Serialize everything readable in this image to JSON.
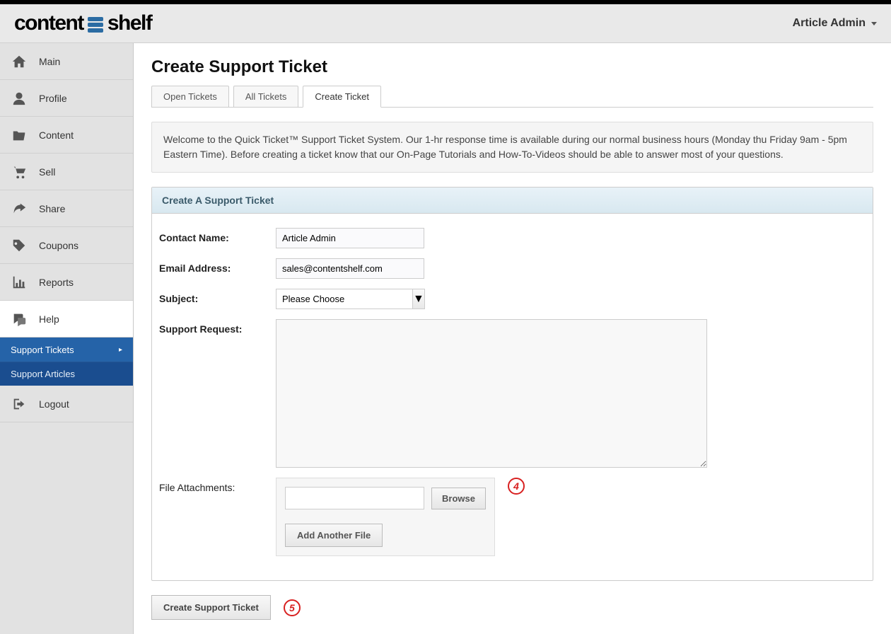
{
  "header": {
    "logo_left": "content",
    "logo_right": "shelf",
    "user_menu": "Article Admin"
  },
  "sidebar": {
    "items": [
      {
        "label": "Main"
      },
      {
        "label": "Profile"
      },
      {
        "label": "Content"
      },
      {
        "label": "Sell"
      },
      {
        "label": "Share"
      },
      {
        "label": "Coupons"
      },
      {
        "label": "Reports"
      },
      {
        "label": "Help"
      }
    ],
    "help_sub": [
      {
        "label": "Support Tickets"
      },
      {
        "label": "Support Articles"
      }
    ],
    "logout": "Logout"
  },
  "page": {
    "title": "Create Support Ticket",
    "tabs": [
      {
        "label": "Open Tickets"
      },
      {
        "label": "All Tickets"
      },
      {
        "label": "Create Ticket"
      }
    ],
    "info": "Welcome to the Quick Ticket™ Support Ticket System. Our 1-hr response time is available during our normal business hours (Monday thu Friday 9am - 5pm Eastern Time). Before creating a ticket know that our On-Page Tutorials and How-To-Videos should be able to answer most of your questions.",
    "panel_title": "Create A Support Ticket",
    "form": {
      "contact_label": "Contact Name:",
      "contact_value": "Article Admin",
      "email_label": "Email Address:",
      "email_value": "sales@contentshelf.com",
      "subject_label": "Subject:",
      "subject_value": "Please Choose",
      "request_label": "Support Request:",
      "attach_label": "File Attachments:",
      "browse_btn": "Browse",
      "add_file_btn": "Add Another File",
      "submit_btn": "Create Support Ticket"
    },
    "step_4": "4",
    "step_5": "5"
  }
}
